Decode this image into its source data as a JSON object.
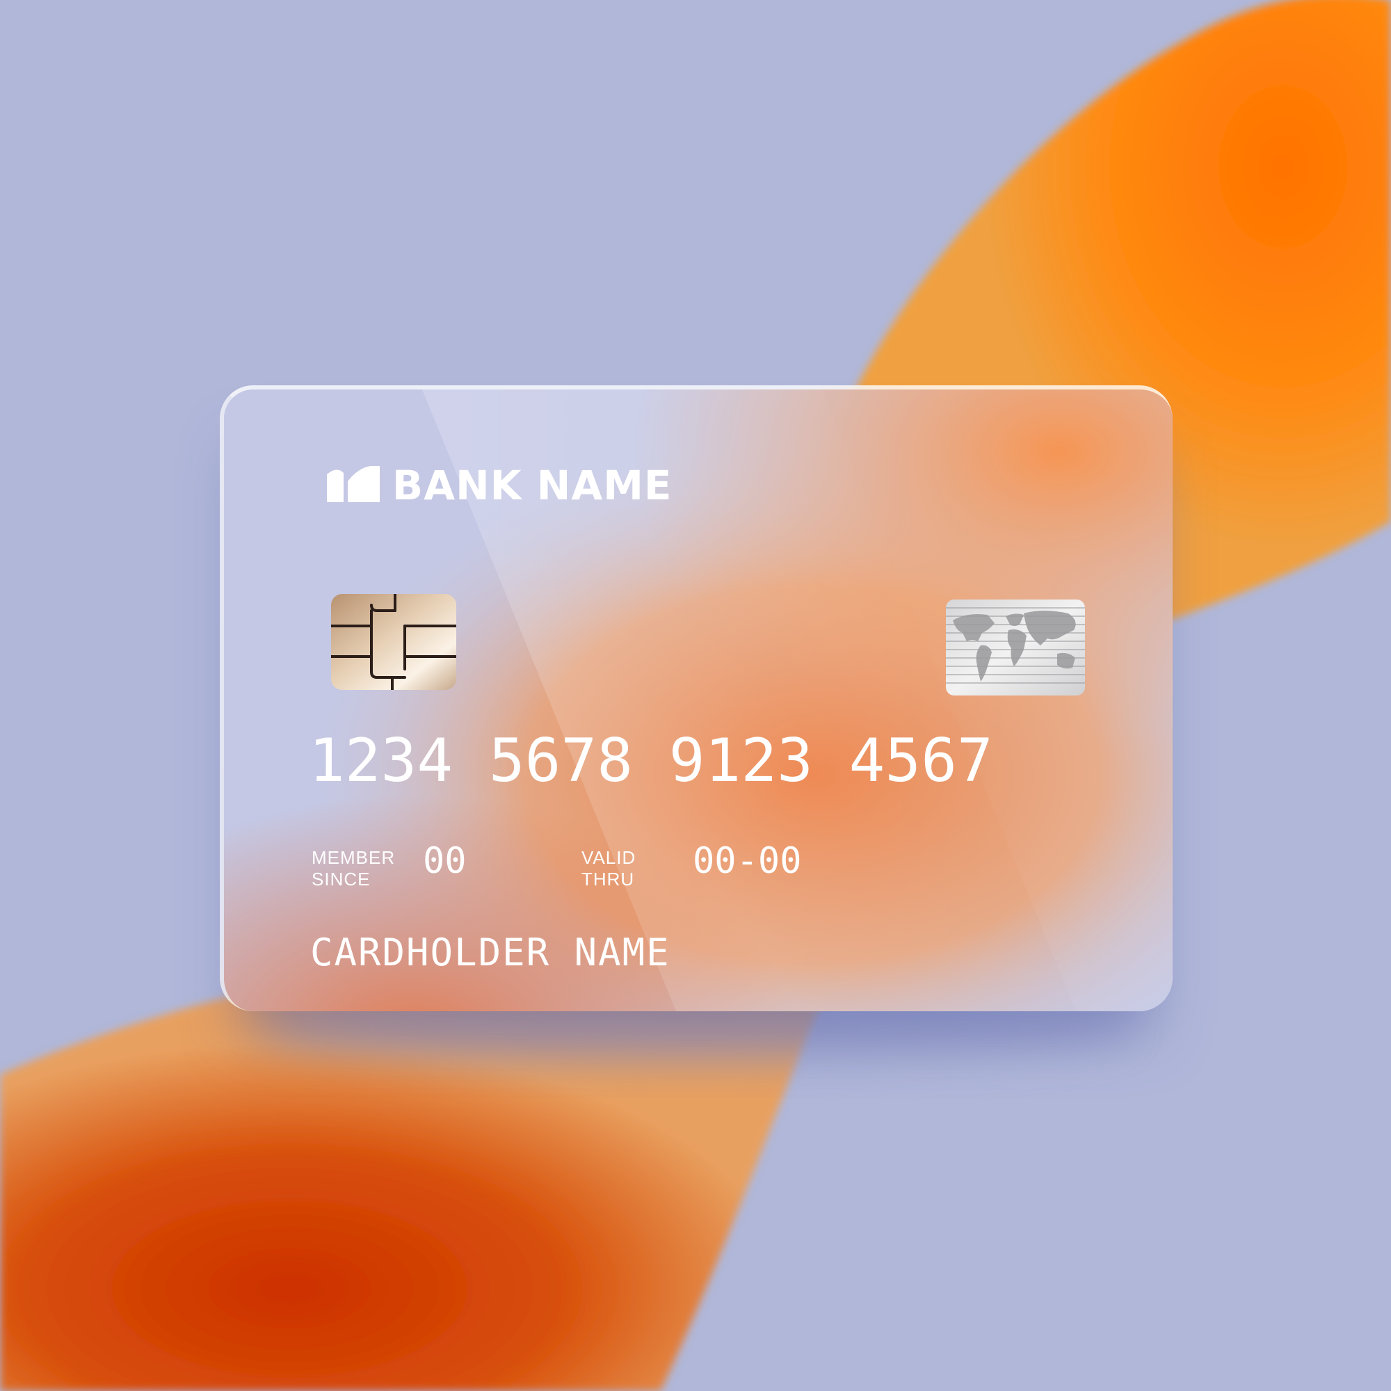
{
  "card": {
    "bank_name": "BANK NAME",
    "number": "1234 5678 9123 4567",
    "member_since_label_line1": "MEMBER",
    "member_since_label_line2": "SINCE",
    "member_since_value": "00",
    "valid_thru_label_line1": "VALID",
    "valid_thru_label_line2": "THRU",
    "valid_thru_value": "00-00",
    "cardholder_name": "CARDHOLDER NAME"
  },
  "icons": {
    "bank_logo": "bank-logo-icon",
    "chip": "emv-chip-icon",
    "hologram": "globe-hologram-icon"
  },
  "colors": {
    "background": "#b0b7d9",
    "accent_orange": "#ff7a00",
    "deep_orange": "#d93c00",
    "card_text": "#ffffff"
  }
}
